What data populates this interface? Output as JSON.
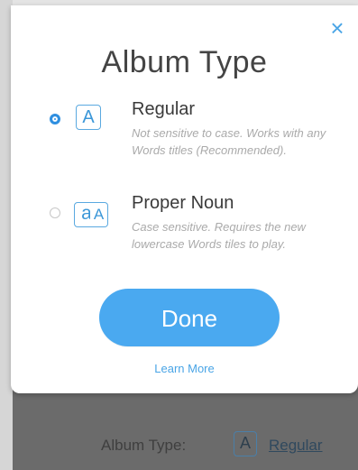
{
  "modal": {
    "title": "Album Type",
    "close_label": "×",
    "options": [
      {
        "badge": "A",
        "label": "Regular",
        "description": "Not sensitive to case. Works with any Words titles (Recommended).",
        "selected": true
      },
      {
        "badge_left": "a",
        "badge_right": "A",
        "label": "Proper Noun",
        "description": "Case sensitive. Requires the new lowercase Words tiles to play.",
        "selected": false
      }
    ],
    "done_label": "Done",
    "learn_more_label": "Learn More"
  },
  "footer": {
    "label": "Album Type:",
    "badge": "A",
    "value": "Regular"
  },
  "colors": {
    "accent": "#4aa9f0",
    "overlay": "#6b6b6b"
  }
}
